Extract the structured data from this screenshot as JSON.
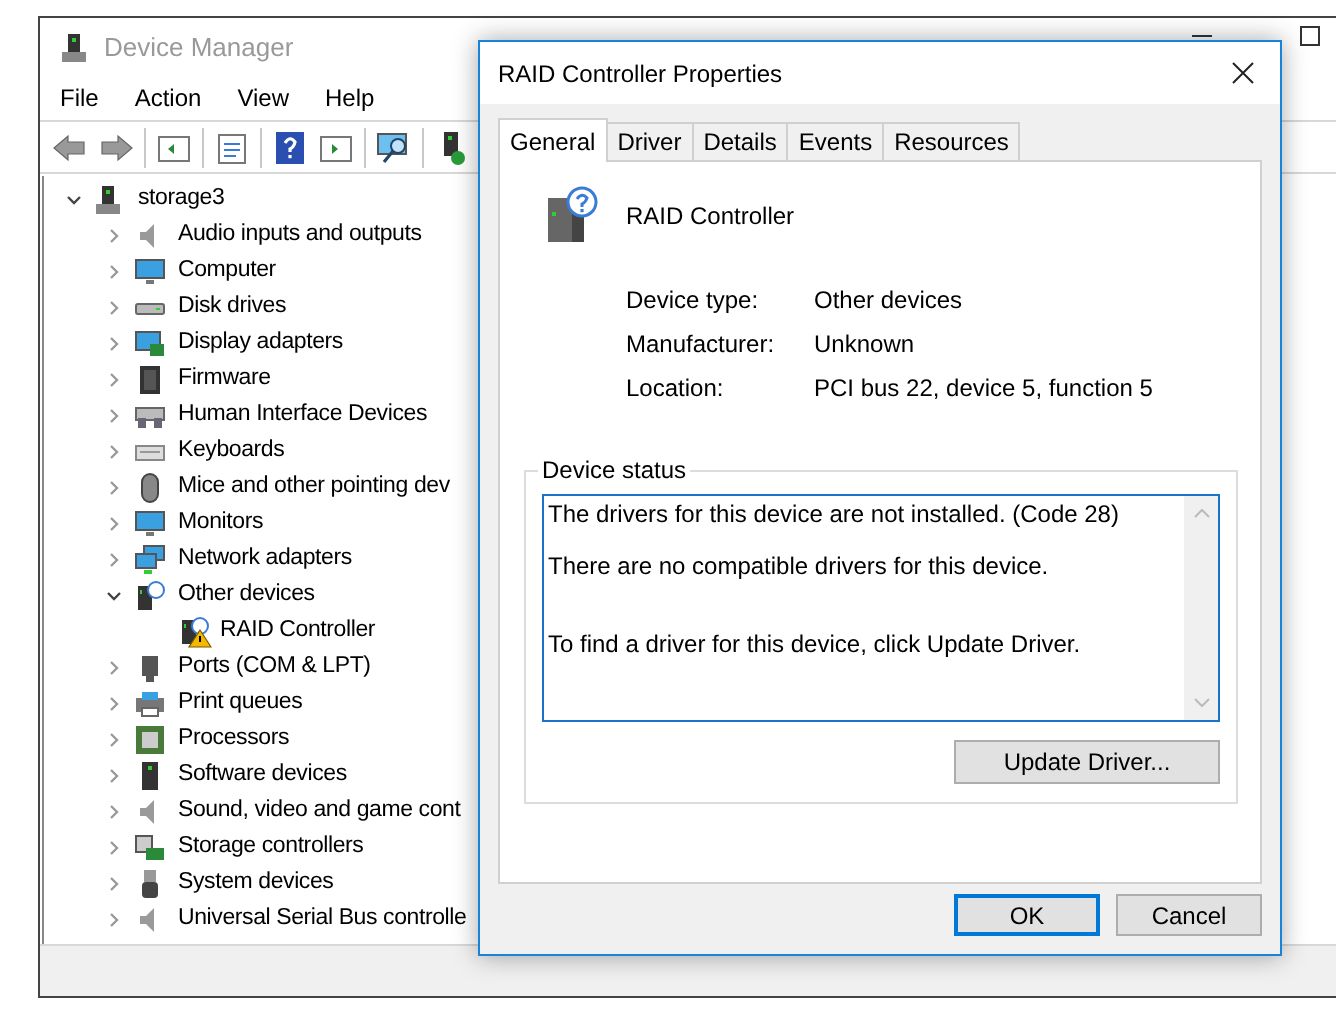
{
  "main_window": {
    "title": "Device Manager",
    "menu": [
      "File",
      "Action",
      "View",
      "Help"
    ],
    "tree": {
      "label": "storage3",
      "expanded": true,
      "children": [
        {
          "label": "Audio inputs and outputs",
          "expanded": false
        },
        {
          "label": "Computer",
          "expanded": false
        },
        {
          "label": "Disk drives",
          "expanded": false
        },
        {
          "label": "Display adapters",
          "expanded": false
        },
        {
          "label": "Firmware",
          "expanded": false
        },
        {
          "label": "Human Interface Devices",
          "expanded": false
        },
        {
          "label": "Keyboards",
          "expanded": false
        },
        {
          "label": "Mice and other pointing dev",
          "expanded": false
        },
        {
          "label": "Monitors",
          "expanded": false
        },
        {
          "label": "Network adapters",
          "expanded": false
        },
        {
          "label": "Other devices",
          "expanded": true,
          "children": [
            {
              "label": "RAID Controller"
            }
          ]
        },
        {
          "label": "Ports (COM & LPT)",
          "expanded": false
        },
        {
          "label": "Print queues",
          "expanded": false
        },
        {
          "label": "Processors",
          "expanded": false
        },
        {
          "label": "Software devices",
          "expanded": false
        },
        {
          "label": "Sound, video and game cont",
          "expanded": false
        },
        {
          "label": "Storage controllers",
          "expanded": false
        },
        {
          "label": "System devices",
          "expanded": false
        },
        {
          "label": "Universal Serial Bus controlle",
          "expanded": false
        }
      ]
    }
  },
  "dialog": {
    "title": "RAID Controller Properties",
    "tabs": [
      {
        "label": "General",
        "selected": true
      },
      {
        "label": "Driver",
        "selected": false
      },
      {
        "label": "Details",
        "selected": false
      },
      {
        "label": "Events",
        "selected": false
      },
      {
        "label": "Resources",
        "selected": false
      }
    ],
    "device_name": "RAID Controller",
    "properties": [
      {
        "label": "Device type:",
        "value": "Other devices"
      },
      {
        "label": "Manufacturer:",
        "value": "Unknown"
      },
      {
        "label": "Location:",
        "value": "PCI bus 22, device 5, function 5"
      }
    ],
    "status_group": "Device status",
    "status_lines": [
      "The drivers for this device are not installed. (Code 28)",
      "There are no compatible drivers for this device.",
      "To find a driver for this device, click Update Driver."
    ],
    "update_button": "Update Driver...",
    "buttons": [
      "OK",
      "Cancel"
    ]
  }
}
